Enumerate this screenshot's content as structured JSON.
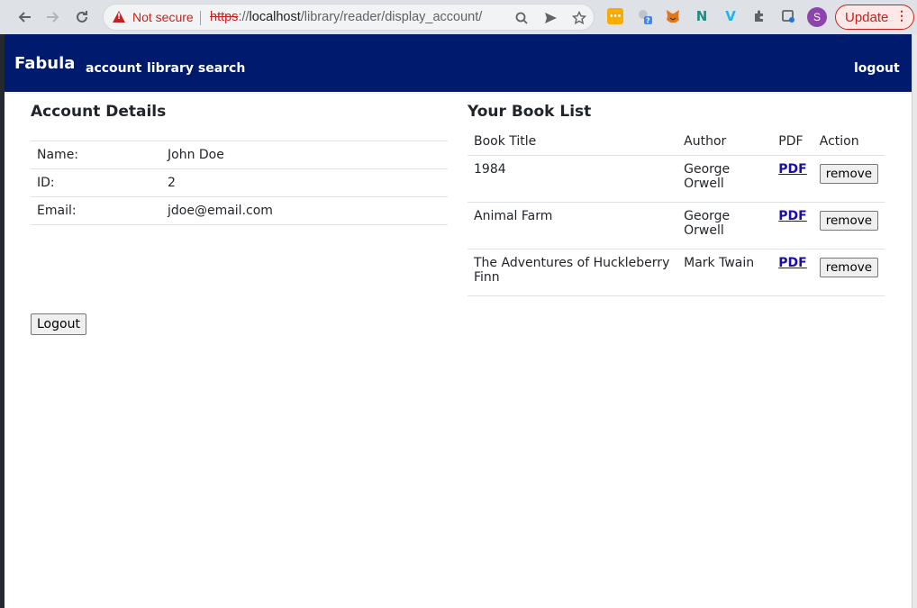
{
  "browser": {
    "security_label": "Not secure",
    "url_scheme": "https",
    "url_sep": "://",
    "url_host": "localhost",
    "url_path": "/library/reader/display_account/",
    "profile_initial": "S",
    "update_label": "Update",
    "icons": [
      "back-icon",
      "forward-icon",
      "reload-icon",
      "warning-icon",
      "zoom-icon",
      "send-icon",
      "bookmark-star-icon",
      "extension-icon",
      "profile-avatar",
      "more-icon"
    ]
  },
  "navbar": {
    "brand": "Fabula",
    "links": [
      "account",
      "library search"
    ],
    "logout": "logout"
  },
  "account": {
    "title": "Account Details",
    "rows": [
      {
        "label": "Name:",
        "value": "John Doe"
      },
      {
        "label": "ID:",
        "value": "2"
      },
      {
        "label": "Email:",
        "value": "jdoe@email.com"
      }
    ],
    "logout_button": "Logout"
  },
  "books": {
    "title": "Your Book List",
    "headers": [
      "Book Title",
      "Author",
      "PDF",
      "Action"
    ],
    "rows": [
      {
        "title": "1984",
        "author": "George Orwell",
        "pdf": "PDF",
        "action": "remove"
      },
      {
        "title": "Animal Farm",
        "author": "George Orwell",
        "pdf": "PDF",
        "action": "remove"
      },
      {
        "title": "The Adventures of Huckleberry Finn",
        "author": "Mark Twain",
        "pdf": "PDF",
        "action": "remove"
      }
    ]
  },
  "colors": {
    "navbar_bg": "#001a6e",
    "link": "#1a0dab",
    "warning": "#c5221f"
  }
}
